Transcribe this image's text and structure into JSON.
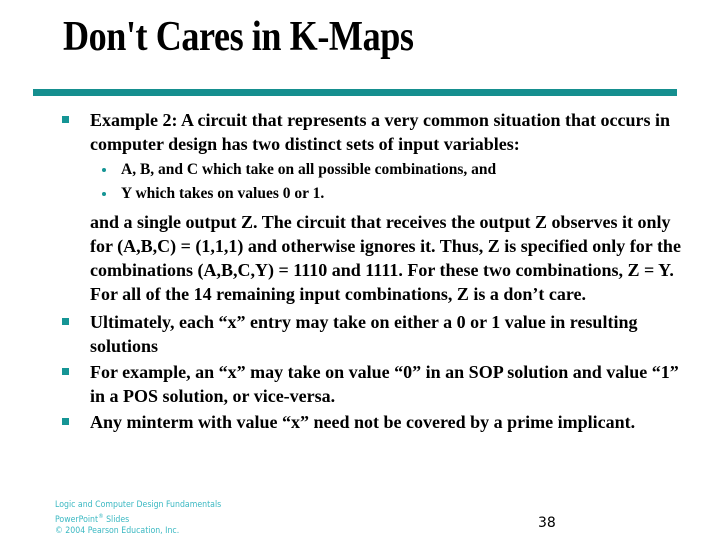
{
  "slide": {
    "title": "Don't Cares in K-Maps",
    "accent_color": "#158f8f",
    "bullets": [
      {
        "text": "Example 2: A circuit that represents a very common situation that occurs in computer design has two distinct sets of input variables:",
        "sub_bullets": [
          "A, B, and C which take on all possible combinations, and",
          "Y which takes on values 0 or 1."
        ],
        "continuation": "and a single output Z. The circuit that receives the output Z observes it only for (A,B,C) = (1,1,1) and otherwise ignores it. Thus, Z is specified only for the combinations (A,B,C,Y) = 1110 and 1111. For these two combinations, Z = Y. For all of the 14 remaining input combinations, Z is a don’t care."
      },
      {
        "text": "Ultimately, each “x” entry may  take on either a 0 or 1 value in resulting solutions"
      },
      {
        "text": "For example, an “x” may take on value “0” in an SOP solution and value “1” in a POS solution, or vice-versa."
      },
      {
        "text": "Any minterm with value “x” need not be covered by a prime implicant."
      }
    ]
  },
  "footer": {
    "line1": "Logic and Computer Design Fundamentals",
    "line2_prefix": "PowerPoint",
    "line2_sup": "®",
    "line2_suffix": " Slides",
    "line3": "© 2004 Pearson Education, Inc.",
    "page_number": "38"
  }
}
